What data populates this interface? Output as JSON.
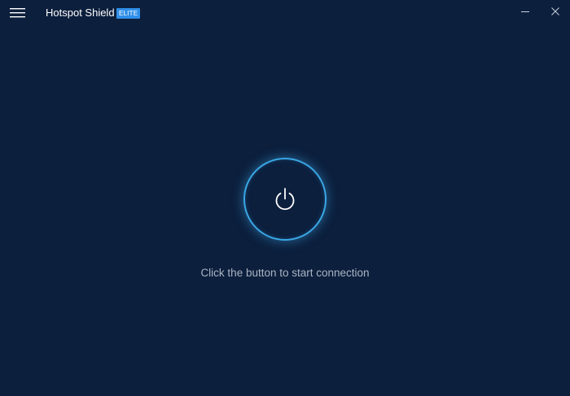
{
  "app": {
    "title": "Hotspot Shield",
    "badge": "ELITE"
  },
  "main": {
    "status_text": "Click the button to start connection"
  },
  "icons": {
    "menu": "hamburger-menu-icon",
    "minimize": "minimize-icon",
    "close": "close-icon",
    "power": "power-icon"
  },
  "colors": {
    "background": "#0c1f3d",
    "accent": "#3aa7e6",
    "badge": "#2f8fe8",
    "status_text": "#aab4c3"
  }
}
